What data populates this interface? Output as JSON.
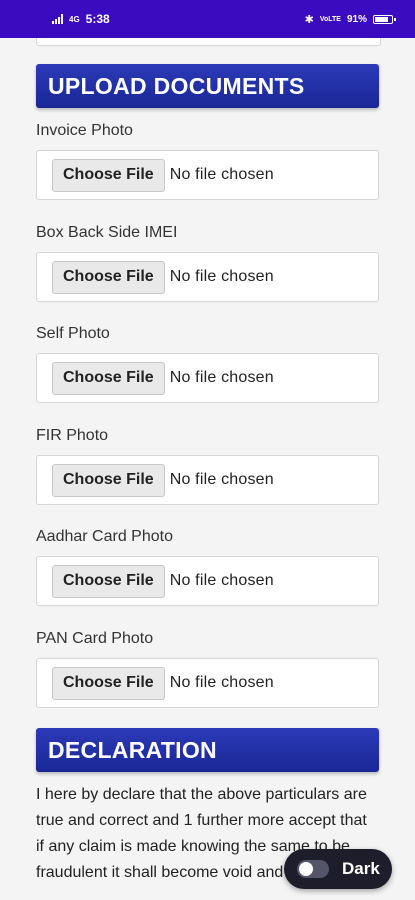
{
  "status_bar": {
    "time": "5:38",
    "network_left": "4G",
    "network_right": "VoLTE",
    "battery": "91%",
    "battery_level": 0.91
  },
  "upload_section": {
    "title": "UPLOAD DOCUMENTS",
    "fields": [
      {
        "label": "Invoice Photo",
        "button": "Choose File",
        "status": "No file chosen"
      },
      {
        "label": "Box Back Side IMEI",
        "button": "Choose File",
        "status": "No file chosen"
      },
      {
        "label": "Self Photo",
        "button": "Choose File",
        "status": "No file chosen"
      },
      {
        "label": "FIR Photo",
        "button": "Choose File",
        "status": "No file chosen"
      },
      {
        "label": "Aadhar Card Photo",
        "button": "Choose File",
        "status": "No file chosen"
      },
      {
        "label": "PAN Card Photo",
        "button": "Choose File",
        "status": "No file chosen"
      }
    ]
  },
  "declaration": {
    "title": "DECLARATION",
    "text": "I here by declare that the above particulars are true and correct and 1 further more accept that if any claim is made knowing the same to be fraudulent it shall become void and"
  },
  "theme_toggle": {
    "label": "Dark",
    "state": "off"
  },
  "colors": {
    "status_bar": "#3a0bbf",
    "section_header": "#1f2ba5",
    "toggle_bg": "#1d1d2b"
  }
}
